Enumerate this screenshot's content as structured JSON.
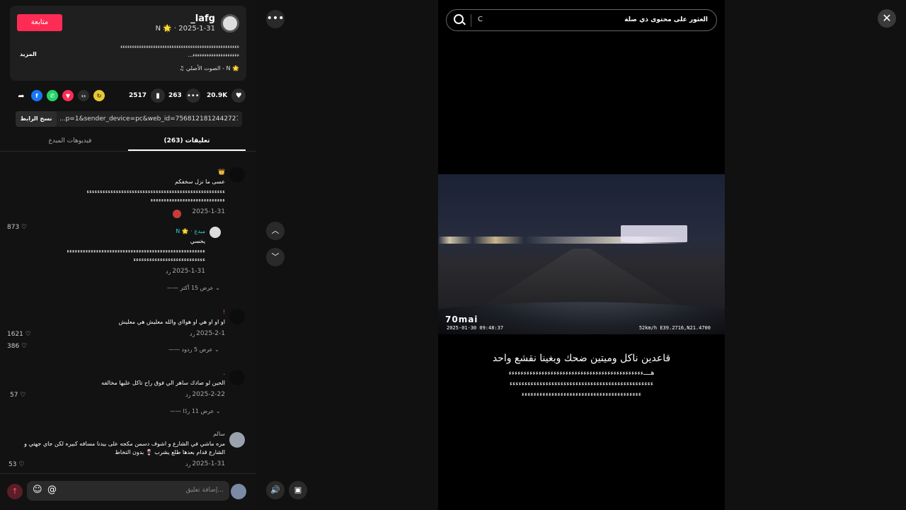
{
  "creator": {
    "name": "_lafg",
    "meta": "N 🌟 · 2025-1-31",
    "follow_label": "متابعة",
    "caption_line1": "ءءءءءءءءءءءءءءءءءءءءءءءءءءءءءءءءءءءءءءءءءءءءءءءءءءء",
    "caption_line2": "...ءءءءءءءءءءءءءءءءءءءء",
    "more_label": "المزيد",
    "sound": "♫ الصوت الأصلي - N 🌟"
  },
  "actions": {
    "likes": "20.9K",
    "comments": "263",
    "bookmarks": "2517"
  },
  "link": {
    "copy_label": "نسخ الرابط",
    "url": "...p=1&sender_device=pc&web_id=7568121812442727956"
  },
  "tabs": {
    "comments_label": "تعليقات (263)",
    "creator_videos_label": "فيديوهات المبدع"
  },
  "comments": [
    {
      "name": "👑",
      "line1": "عسى ما نزل سخفكم",
      "line2": "ءءءءءءءءءءءءءءءءءءءءءءءءءءءءءءءءءءءءءءءءءءءءءءءءءءءء",
      "line3": "ءءءءءءءءءءءءءءءءءءءءءءءءءءءء",
      "date": "2025-1-31",
      "likes": "873"
    },
    {
      "name": "N 🌟 · مبدع",
      "line1": "يخسي",
      "line2": "ءءءءءءءءءءءءءءءءءءءءءءءءءءءءءءءءءءءءءءءءءءءءءءءءءءءء",
      "line3": "ءءءءءءءءءءءءءءءءءءءءءءءءءءء",
      "date": "2025-1-31",
      "reply": "رد",
      "likes": "386"
    },
    {
      "name": "!",
      "line1": "او او او هي او هوااي والله معليش هي معليش",
      "date": "2025-2-1",
      "reply": "رد",
      "likes": "1621"
    },
    {
      "name": ".",
      "line1": "الحين لو صادك ساهر الي فوق راح تاكل عليها مخالفه",
      "date": "2025-2-22",
      "reply": "رد",
      "likes": "57"
    },
    {
      "name": "سالم",
      "line1": "مره ماشي في الشارع و اشوف دسمن مكجه على بيدنا مسافه كبيره لكن جاي جهتي و",
      "line2": "الشارع قدام بعدها طلع يشرب 🍷 بدون التخاط",
      "date": "2025-1-31",
      "reply": "رد",
      "likes": "53"
    }
  ],
  "view_more": {
    "first": "عرض 15 أكثر",
    "second": "عرض 5 ردود",
    "third": "عرض 11 ردًا"
  },
  "input": {
    "placeholder": "إضافة تعليق..."
  },
  "search": {
    "value": "C",
    "placeholder": "العثور على محتوى ذي صلة"
  },
  "video": {
    "brand": "70mai",
    "timestamp": "2025-01-30  09:48:37",
    "speed_coords": "52km/h  E39.2716,N21.4700",
    "overlay_title": "قاعدين ناكل وميتين ضحك وبغينا نقشع واحد",
    "overlay_line1": "هــــءءءءءءءءءءءءءءءءءءءءءءءءءءءءءءءءءءءءءءءءءءءءء",
    "overlay_line2": "ءءءءءءءءءءءءءءءءءءءءءءءءءءءءءءءءءءءءءءءءءءءءءءءء",
    "overlay_line3": "ءءءءءءءءءءءءءءءءءءءءءءءءءءءءءءءءءءءءءءءء"
  },
  "colors": {
    "accent": "#fe2c55"
  }
}
